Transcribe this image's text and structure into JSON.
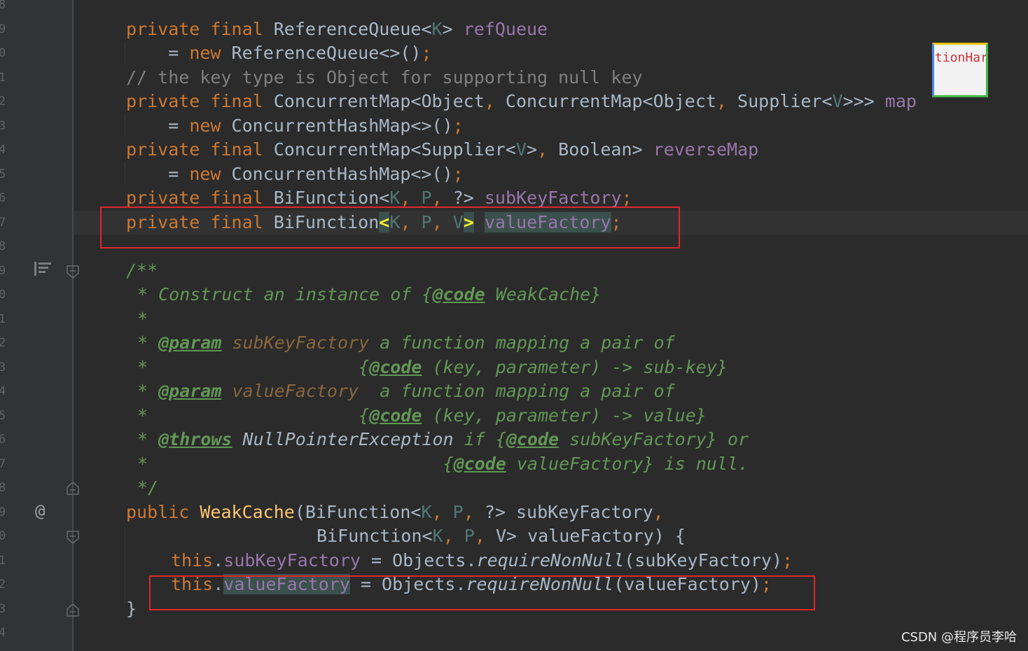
{
  "gutter": {
    "line_numbers": [
      "8",
      "9",
      "0",
      "1",
      "2",
      "3",
      "4",
      "5",
      "6",
      "7",
      "8",
      "9",
      "0",
      "1",
      "2",
      "3",
      "4",
      "5",
      "6",
      "7",
      "8",
      "9",
      "0",
      "1",
      "2",
      "3",
      "4"
    ],
    "icons": [
      "structure-icon",
      "override-at-icon"
    ]
  },
  "code": {
    "l1": {
      "kw": "private final",
      "type": "ReferenceQueue<",
      "tp": "K",
      "close": ">",
      "field": "refQueue"
    },
    "l2": {
      "eq": "= ",
      "kw": "new",
      "rest": "ReferenceQueue<>()",
      "semi": ";"
    },
    "l3": {
      "comment": "// the key type is Object for supporting null key"
    },
    "l4": {
      "kw": "private final",
      "type1": "ConcurrentMap<Object",
      "comma1": ",",
      "type2": "ConcurrentMap<Object",
      "comma2": ",",
      "type3": "Supplier<",
      "tp": "V",
      "close": ">>>",
      "field": "map"
    },
    "l5": {
      "eq": "= ",
      "kw": "new",
      "rest": "ConcurrentHashMap<>()",
      "semi": ";"
    },
    "l6": {
      "kw": "private final",
      "type1": "ConcurrentMap<Supplier<",
      "tp": "V",
      "close": ">",
      "comma": ",",
      "type2": "Boolean>",
      "field": "reverseMap"
    },
    "l7": {
      "eq": "= ",
      "kw": "new",
      "rest": "ConcurrentHashMap<>()",
      "semi": ";"
    },
    "l8": {
      "kw": "private final",
      "type": "BiFunction<",
      "k": "K",
      "c1": ",",
      "p": "P",
      "c2": ",",
      "q": "?>",
      "field": "subKeyFactory",
      "semi": ";"
    },
    "l9": {
      "kw": "private final",
      "type": "BiFunction",
      "lt": "<",
      "k": "K",
      "c1": ",",
      "p": "P",
      "c2": ",",
      "v": "V",
      "gt": ">",
      "field": "valueFactory",
      "semi": ";"
    },
    "doc1": "/**",
    "doc2": {
      "star": "* Construct an instance of ",
      "brace_open": "{",
      "tag": "@code",
      "text": " WeakCache}"
    },
    "doc3": "*",
    "doc4": {
      "star": "* ",
      "tag": "@param",
      "pn": " subKeyFactory",
      "text": " a function mapping a pair of"
    },
    "doc5": {
      "star": "*",
      "pad": "                    ",
      "brace_open": "{",
      "tag": "@code",
      "text": " (key, parameter) -> sub-key}"
    },
    "doc6": {
      "star": "* ",
      "tag": "@param",
      "pn": " valueFactory",
      "text": "  a function mapping a pair of"
    },
    "doc7": {
      "star": "*",
      "pad": "                    ",
      "brace_open": "{",
      "tag": "@code",
      "text": " (key, parameter) -> value}"
    },
    "doc8": {
      "star": "* ",
      "tag": "@throws",
      "exc": " NullPointerException",
      "text1": " if ",
      "brace_open": "{",
      "tag2": "@code",
      "text2": " subKeyFactory} or"
    },
    "doc9": {
      "star": "*",
      "pad": "                            ",
      "brace_open": "{",
      "tag": "@code",
      "text": " valueFactory} is null."
    },
    "doc10": "*/",
    "ctor1": {
      "kw": "public",
      "name": "WeakCache",
      "open": "(BiFunction<",
      "k": "K",
      "c1": ",",
      "p": "P",
      "c2": ",",
      "rest": "?> subKeyFactory",
      "comma": ","
    },
    "ctor2": {
      "type": "BiFunction<",
      "k": "K",
      "c1": ",",
      "p": "P",
      "c2": ",",
      "rest": "V> valueFactory) {"
    },
    "body1": {
      "kw": "this",
      "dot": ".",
      "field": "subKeyFactory",
      "mid": " = Objects.",
      "method": "requireNonNull",
      "args": "(subKeyFactory)",
      "semi": ";"
    },
    "body2": {
      "kw": "this",
      "dot": ".",
      "field": "valueFactory",
      "mid": " = Objects.",
      "method": "requireNonNull",
      "args": "(valueFactory)",
      "semi": ";"
    },
    "close": "}"
  },
  "popup": {
    "text": "tionHar"
  },
  "watermark": "CSDN @程序员李哈",
  "colors": {
    "keyword": "#cc7832",
    "field": "#9876aa",
    "type_param": "#507874",
    "comment": "#808080",
    "javadoc": "#629755",
    "method_decl": "#ffc66d",
    "highlight_box": "#e0262b"
  }
}
